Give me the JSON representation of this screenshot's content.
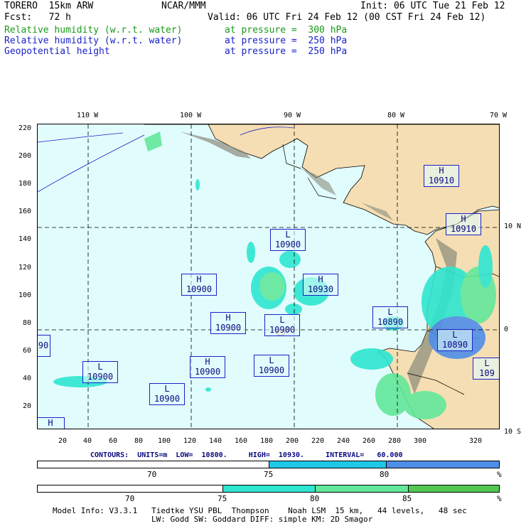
{
  "header": {
    "model": "TORERO  15km ARW",
    "org": "NCAR/MMM",
    "init": "Init: 06 UTC Tue 21 Feb 12",
    "fcst": "Fcst:   72 h",
    "valid": "Valid: 06 UTC Fri 24 Feb 12 (00 CST Fri 24 Feb 12)",
    "fields": [
      {
        "name": "Relative humidity (w.r.t. water)",
        "level": "at pressure =  300 hPa",
        "color": "#1a9a1a"
      },
      {
        "name": "Relative humidity (w.r.t. water)",
        "level": "at pressure =  250 hPa",
        "color": "#1a22c8"
      },
      {
        "name": "Geopotential height",
        "level": "at pressure =  250 hPa",
        "color": "#1a22c8"
      }
    ]
  },
  "map": {
    "lon_labels": [
      "110 W",
      "100 W",
      "90 W",
      "80 W",
      "70 W"
    ],
    "lat_labels": [
      "10 N",
      "0",
      "10 S"
    ],
    "y_ticks": [
      "220",
      "200",
      "180",
      "160",
      "140",
      "120",
      "100",
      "80",
      "60",
      "40",
      "20"
    ],
    "x_ticks": [
      "20",
      "40",
      "60",
      "80",
      "100",
      "120",
      "140",
      "160",
      "180",
      "200",
      "220",
      "240",
      "260",
      "280",
      "300",
      "320"
    ],
    "centers": [
      {
        "type": "H",
        "value": "10910"
      },
      {
        "type": "H",
        "value": "10910"
      },
      {
        "type": "L",
        "value": "10900"
      },
      {
        "type": "H",
        "value": "10900"
      },
      {
        "type": "H",
        "value": "10930"
      },
      {
        "type": "H",
        "value": "10900"
      },
      {
        "type": "L",
        "value": "10900"
      },
      {
        "type": "L",
        "value": "10890"
      },
      {
        "type": "L",
        "value": "10890"
      },
      {
        "type": "L",
        "value": "10900"
      },
      {
        "type": "H",
        "value": "10900"
      },
      {
        "type": "L",
        "value": "10900"
      },
      {
        "type": "L",
        "value": "10900"
      },
      {
        "type": "",
        "value": "90"
      },
      {
        "type": "L",
        "value": "109"
      },
      {
        "type": "H",
        "value": ""
      }
    ]
  },
  "contours": {
    "text": "CONTOURS:  UNITS=m  LOW=  10800.     HIGH=  10930.     INTERVAL=   60.000"
  },
  "colorbar_250": {
    "labels": [
      "70",
      "75",
      "80",
      "%"
    ],
    "colors": [
      "#ffffff",
      "#1ec8e8",
      "#4f8ee8"
    ]
  },
  "colorbar_300": {
    "labels": [
      "70",
      "75",
      "80",
      "85",
      "%"
    ],
    "colors": [
      "#ffffff",
      "#2ee6d0",
      "#62e89a",
      "#52c852"
    ]
  },
  "footer": {
    "line1": "Model Info: V3.3.1   Tiedtke YSU PBL  Thompson    Noah LSM  15 km,   44 levels,   48 sec",
    "line2": "LW: Godd SW: Goddard DIFF: simple KM: 2D Smagor"
  }
}
